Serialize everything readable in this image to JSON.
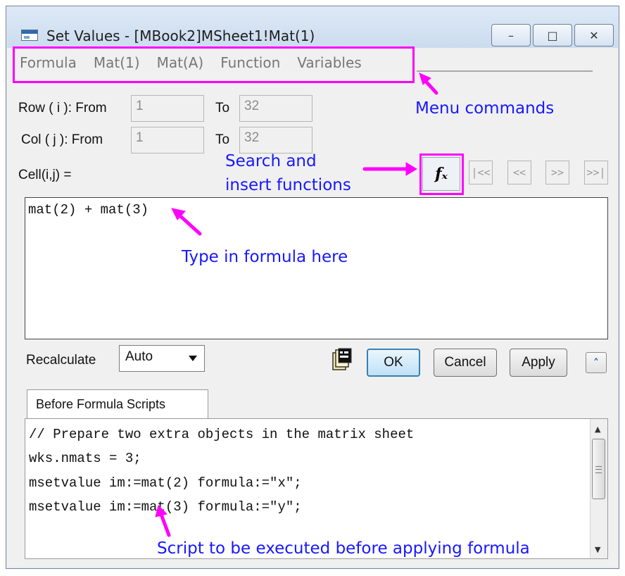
{
  "window": {
    "title": "Set Values - [MBook2]MSheet1!Mat(1)",
    "controls": {
      "minimize": "–",
      "maximize": "□",
      "close": "✕"
    }
  },
  "menu": {
    "items": [
      "Formula",
      "Mat(1)",
      "Mat(A)",
      "Function",
      "Variables"
    ]
  },
  "row": {
    "label": "Row ( i ):  From",
    "from": "1",
    "to_label": "To",
    "to": "32"
  },
  "col": {
    "label": "Col  ( j ):  From",
    "from": "1",
    "to_label": "To",
    "to": "32"
  },
  "cell_label": "Cell(i,j) =",
  "function_button_glyph": "fₓ",
  "nav_buttons": [
    "|<<",
    "<<",
    ">>",
    ">>|"
  ],
  "formula": "mat(2) + mat(3)",
  "recalculate": {
    "label": "Recalculate",
    "value": "Auto"
  },
  "buttons": {
    "ok": "OK",
    "cancel": "Cancel",
    "apply": "Apply",
    "expand": "˄"
  },
  "tab_label": "Before Formula Scripts",
  "script_lines": [
    "// Prepare two extra objects in the matrix sheet",
    "wks.nmats = 3;",
    "msetvalue im:=mat(2) formula:=\"x\";",
    "msetvalue im:=mat(3) formula:=\"y\";"
  ],
  "annotations": {
    "menu": "Menu commands",
    "search_line1": "Search and",
    "search_line2": "insert functions",
    "formula": "Type in formula here",
    "script": "Script to be executed before applying formula"
  },
  "colors": {
    "highlight": "#ff00ff",
    "annotation_text": "#1818ff"
  }
}
